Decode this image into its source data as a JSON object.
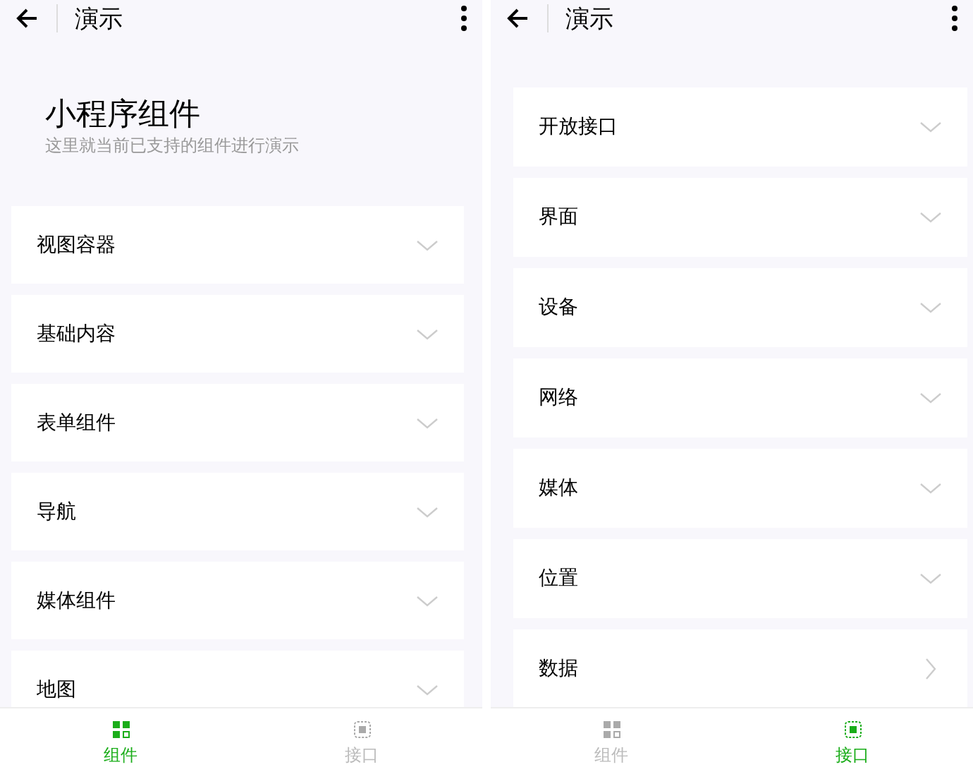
{
  "screens": [
    {
      "title": "演示",
      "hero": {
        "title": "小程序组件",
        "subtitle": "这里就当前已支持的组件进行演示"
      },
      "items": [
        {
          "label": "视图容器",
          "kind": "expand"
        },
        {
          "label": "基础内容",
          "kind": "expand"
        },
        {
          "label": "表单组件",
          "kind": "expand"
        },
        {
          "label": "导航",
          "kind": "expand"
        },
        {
          "label": "媒体组件",
          "kind": "expand"
        },
        {
          "label": "地图",
          "kind": "expand"
        }
      ],
      "tabs": [
        {
          "label": "组件",
          "selected": true,
          "kind": "grid"
        },
        {
          "label": "接口",
          "selected": false,
          "kind": "chip"
        }
      ]
    },
    {
      "title": "演示",
      "items": [
        {
          "label": "开放接口",
          "kind": "expand"
        },
        {
          "label": "界面",
          "kind": "expand"
        },
        {
          "label": "设备",
          "kind": "expand"
        },
        {
          "label": "网络",
          "kind": "expand"
        },
        {
          "label": "媒体",
          "kind": "expand"
        },
        {
          "label": "位置",
          "kind": "expand"
        },
        {
          "label": "数据",
          "kind": "link"
        }
      ],
      "tabs": [
        {
          "label": "组件",
          "selected": false,
          "kind": "grid"
        },
        {
          "label": "接口",
          "selected": true,
          "kind": "chip"
        }
      ]
    }
  ]
}
